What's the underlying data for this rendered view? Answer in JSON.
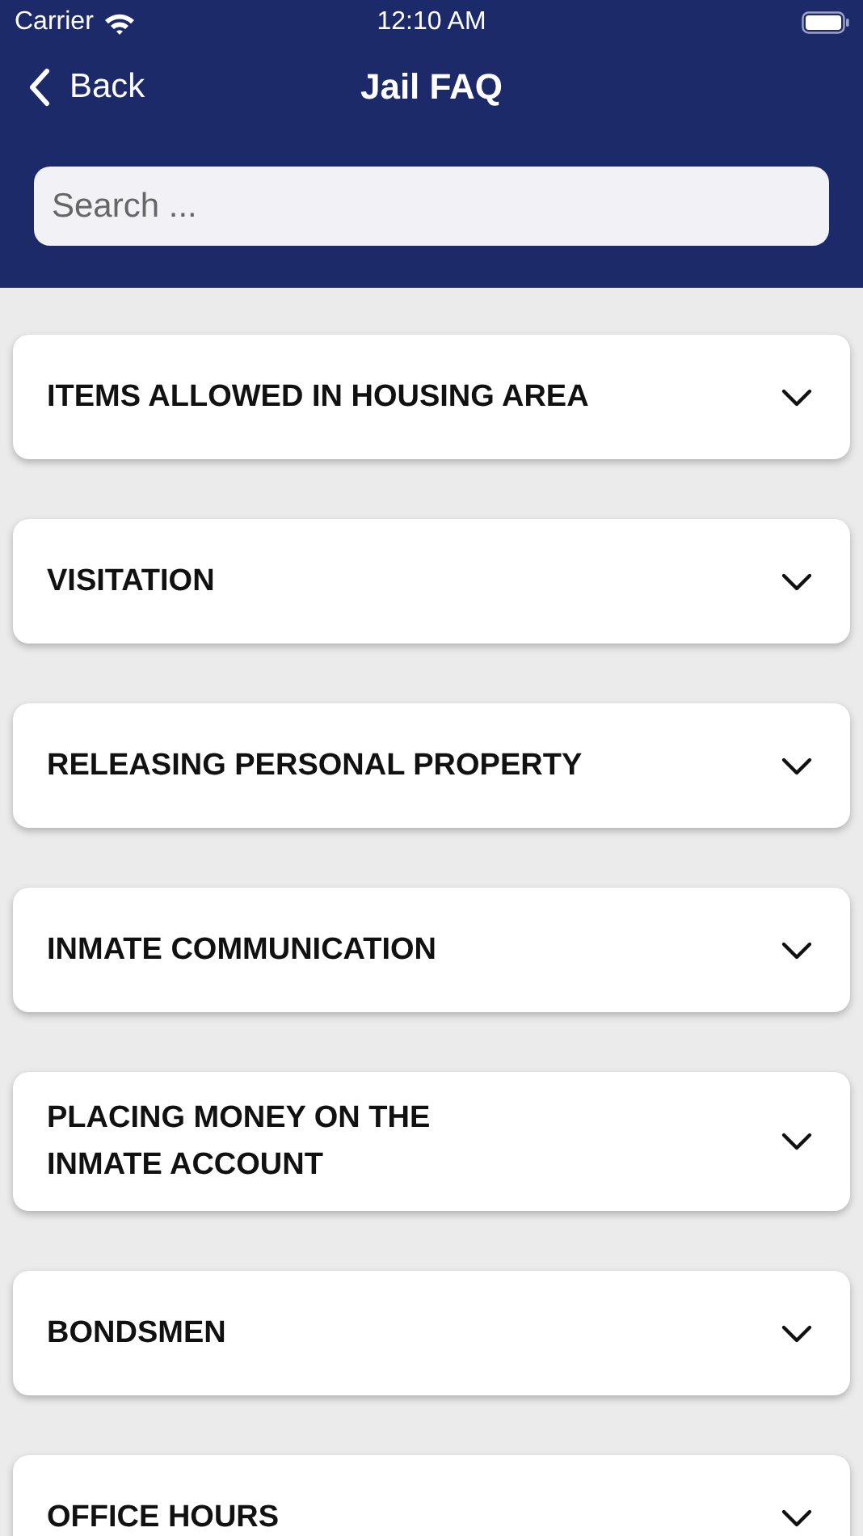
{
  "status_bar": {
    "carrier": "Carrier",
    "time": "12:10 AM"
  },
  "nav": {
    "back": "Back",
    "title": "Jail FAQ"
  },
  "search": {
    "placeholder": "Search ..."
  },
  "faq_items": [
    {
      "title": "ITEMS ALLOWED IN HOUSING AREA"
    },
    {
      "title": "VISITATION"
    },
    {
      "title": "RELEASING PERSONAL PROPERTY"
    },
    {
      "title": "INMATE COMMUNICATION"
    },
    {
      "title": "PLACING MONEY ON THE INMATE ACCOUNT"
    },
    {
      "title": "BONDSMEN"
    },
    {
      "title": "OFFICE HOURS"
    }
  ]
}
